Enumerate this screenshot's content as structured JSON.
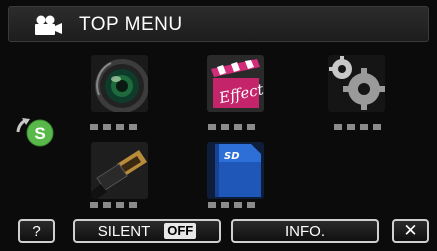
{
  "header": {
    "title": "TOP MENU",
    "mode_icon": "video-camera-icon"
  },
  "menu": {
    "items": [
      {
        "icon": "lens-icon"
      },
      {
        "icon": "effect-clapper-icon"
      },
      {
        "icon": "gears-icon"
      },
      {
        "icon": "hdmi-cable-icon"
      },
      {
        "icon": "sd-card-icon"
      }
    ],
    "side_icon": "s-rotate-icon",
    "side_icon_text": "S",
    "page_dots": 4
  },
  "bottom": {
    "help_label": "?",
    "silent_label": "SILENT",
    "silent_state": "OFF",
    "info_label": "INFO.",
    "close_label": "✕"
  },
  "colors": {
    "background": "#0b0b0b",
    "accent_green": "#58b84a",
    "dot_gray": "#8b8b8b"
  }
}
